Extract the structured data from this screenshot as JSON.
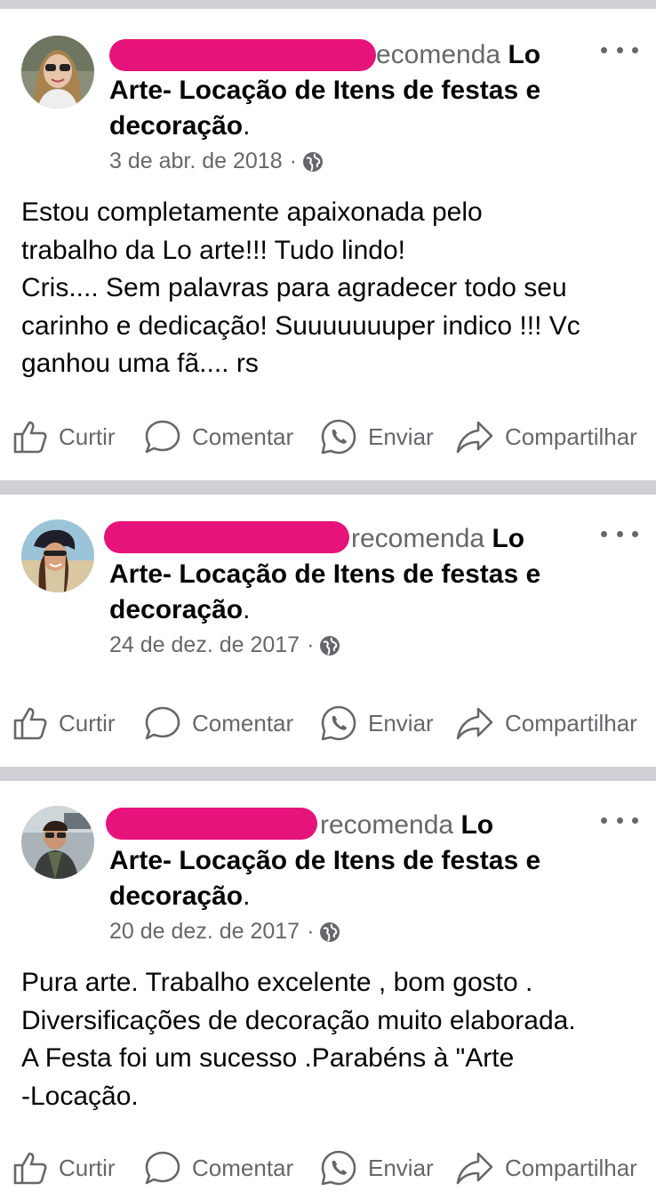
{
  "posts": [
    {
      "recommends_text": "recomenda",
      "recommends_text_cut": "ecomenda",
      "page_name_line1": "Lo",
      "page_name_line2": "Arte- Locação de Itens de festas e",
      "page_name_line3": "decoração",
      "period": ".",
      "date": "3 de abr. de 2018",
      "separator": "·",
      "privacy_icon": "globe-icon",
      "body_lines": [
        "Estou completamente apaixonada pelo",
        "trabalho da Lo arte!!! Tudo lindo!",
        "Cris.... Sem palavras para agradecer todo seu",
        "carinho e dedicação! Suuuuuuuper indico !!! Vc",
        "ganhou uma fã.... rs"
      ]
    },
    {
      "recommends_text": "recomenda",
      "page_name_line1": "Lo",
      "page_name_line2": "Arte- Locação de Itens de festas e",
      "page_name_line3": "decoração",
      "period": ".",
      "date": "24 de dez. de 2017",
      "separator": "·",
      "privacy_icon": "globe-icon",
      "body_lines": []
    },
    {
      "recommends_text": "recomenda",
      "page_name_line1": "Lo",
      "page_name_line2": "Arte- Locação de Itens de festas e",
      "page_name_line3": "decoração",
      "period": ".",
      "date": "20 de dez. de 2017",
      "separator": "·",
      "privacy_icon": "globe-icon",
      "body_lines": [
        "Pura arte. Trabalho  excelente , bom gosto .",
        "Diversificações de decoração  muito elaborada.",
        "A Festa foi um sucesso .Parabéns à \"Arte",
        "-Locação."
      ]
    }
  ],
  "actions": {
    "like": "Curtir",
    "comment": "Comentar",
    "send": "Enviar",
    "share": "Compartilhar"
  },
  "colors": {
    "redaction": "#e5137a",
    "separator": "#ced0d4",
    "secondary_text": "#65676b",
    "primary_text": "#050505"
  }
}
